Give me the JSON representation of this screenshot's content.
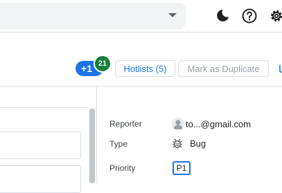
{
  "topbar": {
    "icons": [
      "moon-icon",
      "help-icon",
      "settings-gear-icon",
      "dropdown-caret-icon"
    ]
  },
  "actions": {
    "plus_one_label": "+1",
    "plus_one_count": "21",
    "hotlists_label": "Hotlists (5)",
    "mark_duplicate_label": "Mark as Duplicate"
  },
  "details": {
    "reporter_label": "Reporter",
    "reporter_value": "to...@gmail.com",
    "type_label": "Type",
    "type_value": "Bug",
    "priority_label": "Priority",
    "priority_value": "P1"
  },
  "colors": {
    "accent": "#1a73e8",
    "badge_green": "#188038"
  }
}
